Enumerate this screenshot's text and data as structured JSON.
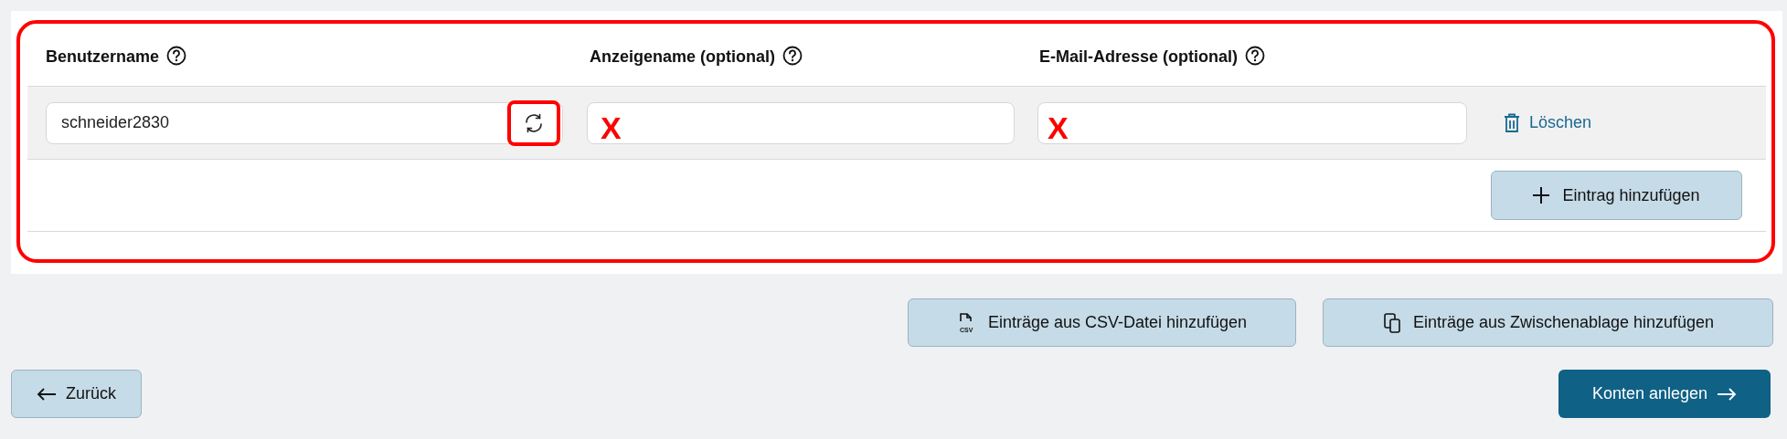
{
  "panel": {
    "highlighted": true,
    "columns": [
      {
        "label": "Benutzername"
      },
      {
        "label": "Anzeigename (optional)"
      },
      {
        "label": "E-Mail-Adresse (optional)"
      }
    ],
    "rows": [
      {
        "username": "schneider2830",
        "refresh_highlighted": true,
        "display_name_mark": "X",
        "email_mark": "X",
        "delete_label": "Löschen"
      }
    ],
    "add_button": "Eintrag hinzufügen"
  },
  "import_buttons": [
    {
      "kind": "csv",
      "icon_text": "CSV",
      "label": "Einträge aus CSV-Datei hinzufügen"
    },
    {
      "kind": "clipboard",
      "label": "Einträge aus Zwischenablage hinzufügen"
    }
  ],
  "back_button": "Zurück",
  "submit_button": "Konten anlegen"
}
